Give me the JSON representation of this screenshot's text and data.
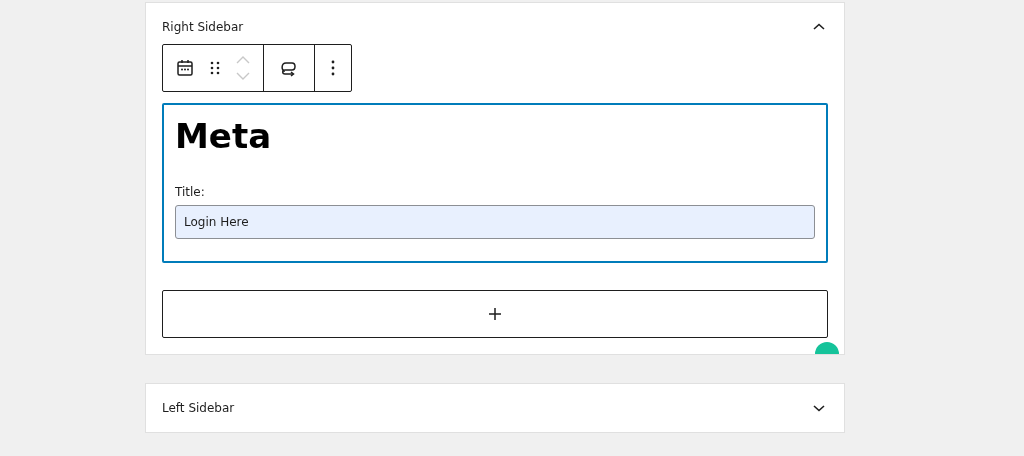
{
  "panels": [
    {
      "title": "Right Sidebar",
      "expanded": true,
      "block": {
        "heading": "Meta",
        "field_label": "Title:",
        "field_value": "Login Here"
      }
    },
    {
      "title": "Left Sidebar",
      "expanded": false
    }
  ]
}
